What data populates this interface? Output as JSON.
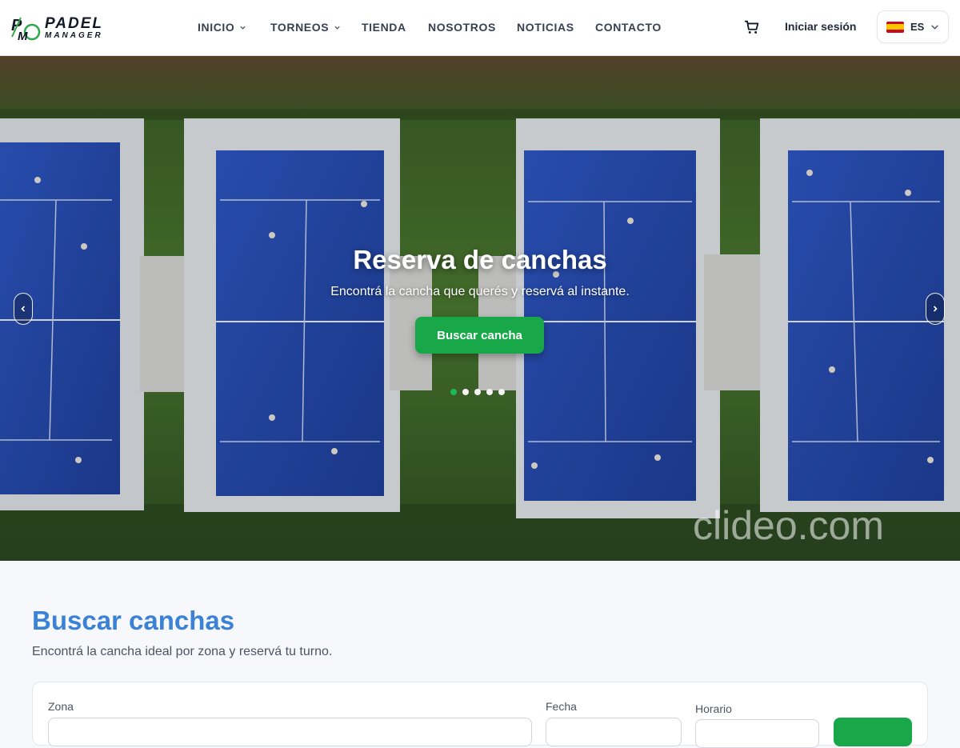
{
  "brand": {
    "word1": "PADEL",
    "word2": "MANAGER"
  },
  "nav": {
    "items": [
      {
        "label": "INICIO",
        "dropdown": true
      },
      {
        "label": "TORNEOS",
        "dropdown": true
      },
      {
        "label": "TIENDA",
        "dropdown": false
      },
      {
        "label": "NOSOTROS",
        "dropdown": false
      },
      {
        "label": "NOTICIAS",
        "dropdown": false
      },
      {
        "label": "CONTACTO",
        "dropdown": false
      }
    ],
    "login_label": "Iniciar sesión",
    "language": "ES",
    "cart_icon": "cart-icon"
  },
  "hero": {
    "title": "Reserva de canchas",
    "subtitle": "Encontrá la cancha que querés y reservá al instante.",
    "button_label": "Buscar cancha",
    "slides_total": 5,
    "active_slide": 1,
    "watermark": "clideo.com"
  },
  "search": {
    "title": "Buscar canchas",
    "subtitle": "Encontrá la cancha ideal por zona y reservá tu turno.",
    "zona_label": "Zona",
    "fecha_label": "Fecha",
    "horario_label": "Horario"
  },
  "colors": {
    "accent_green": "#18a84a",
    "title_blue": "#3b82d6",
    "court_blue": "#2a4fb8"
  }
}
